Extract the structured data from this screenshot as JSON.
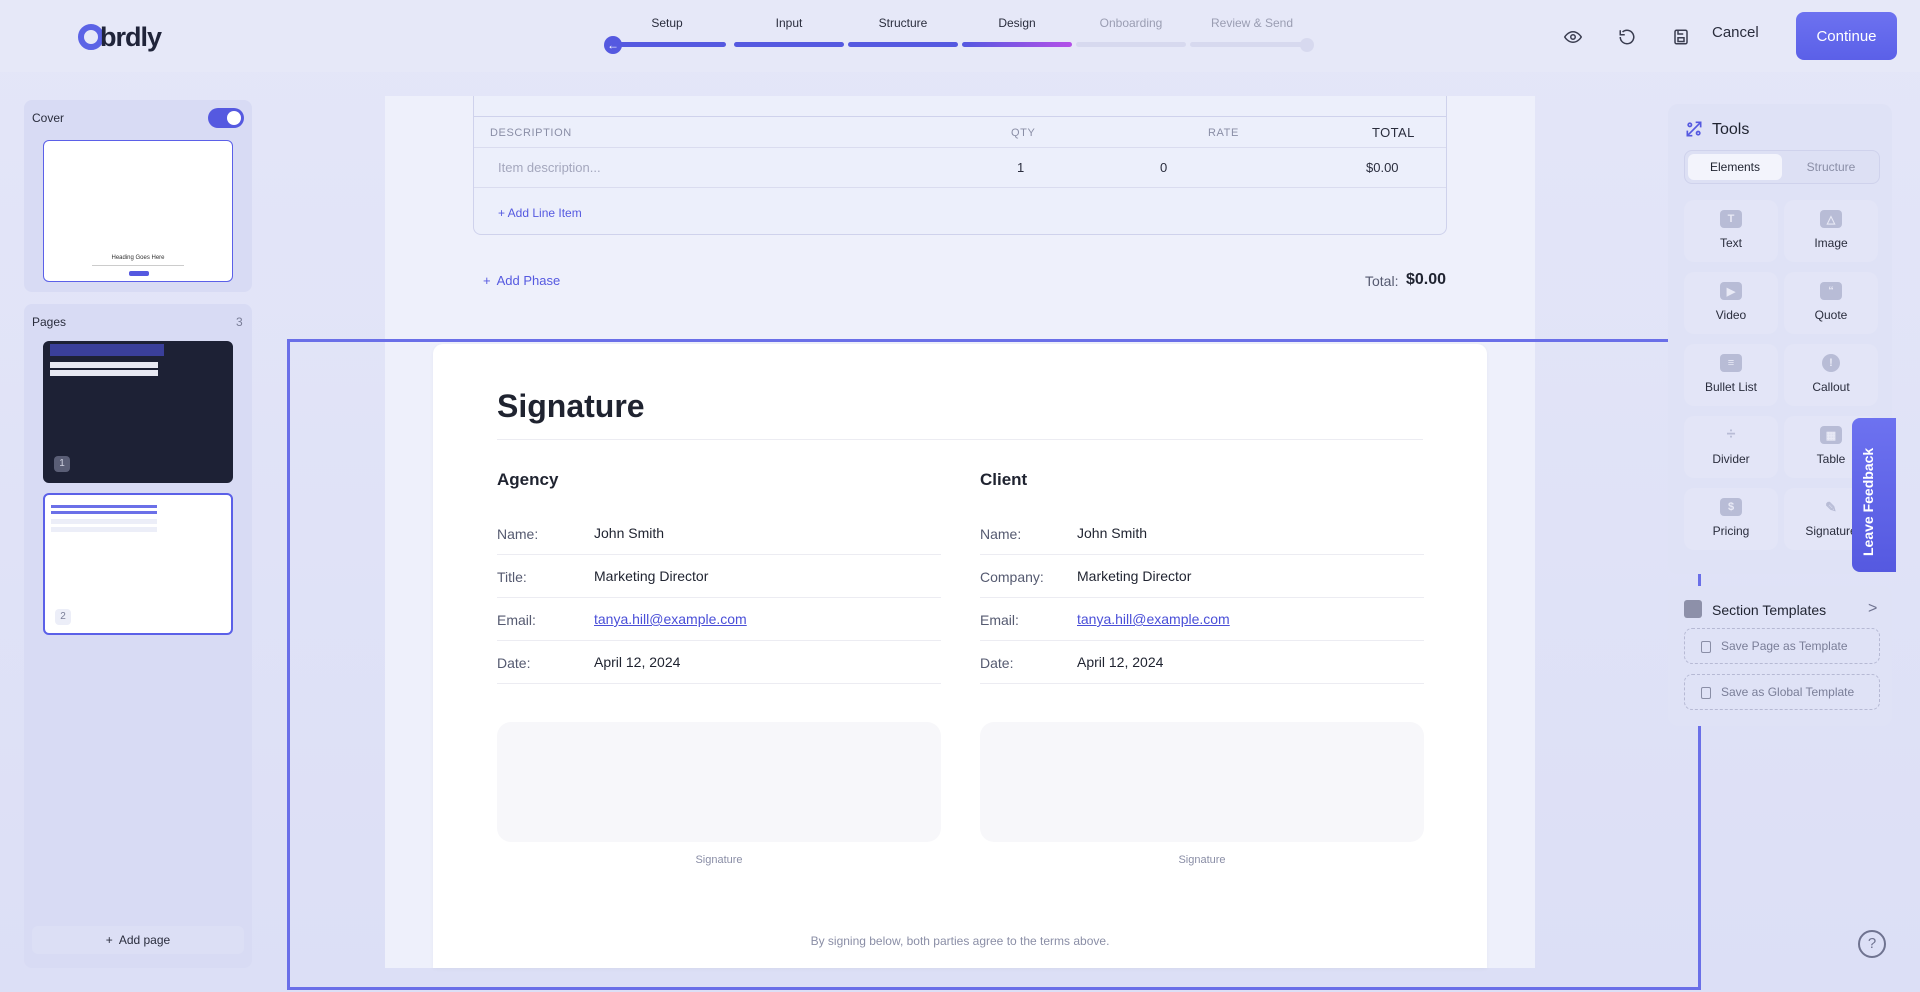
{
  "app": {
    "logo_text": "brdly",
    "colors": {
      "accent": "#5559e0",
      "accent_gradient_end": "#b450e8",
      "link": "#4a4fd8"
    }
  },
  "stepper": {
    "steps": [
      {
        "label": "Setup",
        "state": "done"
      },
      {
        "label": "Input",
        "state": "done"
      },
      {
        "label": "Structure",
        "state": "done"
      },
      {
        "label": "Design",
        "state": "active"
      },
      {
        "label": "Onboarding",
        "state": "pending"
      },
      {
        "label": "Review & Send",
        "state": "pending"
      }
    ]
  },
  "header_actions": {
    "preview_icon": "eye-icon",
    "history_icon": "undo-icon",
    "save_icon": "save-icon",
    "cancel_label": "Cancel",
    "continue_label": "Continue"
  },
  "left_panel": {
    "cover": {
      "label": "Cover",
      "enabled": true,
      "thumbnail_heading": "Heading Goes Here"
    },
    "pages": {
      "label": "Pages",
      "count": "3",
      "items": [
        {
          "number": "1"
        },
        {
          "number": "2"
        }
      ]
    },
    "add_page_label": "Add page"
  },
  "invoice": {
    "columns": {
      "description": "DESCRIPTION",
      "qty": "QTY",
      "rate": "RATE",
      "total": "TOTAL"
    },
    "rows": [
      {
        "description_placeholder": "Item description...",
        "qty": "1",
        "rate": "0",
        "total": "$0.00"
      }
    ],
    "add_line_label": "+ Add Line Item",
    "add_phase_label": "Add Phase",
    "total_label": "Total:",
    "total_value": "$0.00"
  },
  "signature": {
    "title": "Signature",
    "agency": {
      "heading": "Agency",
      "fields": [
        {
          "label": "Name:",
          "value": "John Smith"
        },
        {
          "label": "Title:",
          "value": "Marketing Director"
        },
        {
          "label": "Email:",
          "value": "tanya.hill@example.com"
        },
        {
          "label": "Date:",
          "value": "April 12, 2024"
        }
      ],
      "signature_caption": "Signature"
    },
    "client": {
      "heading": "Client",
      "fields": [
        {
          "label": "Name:",
          "value": "John Smith"
        },
        {
          "label": "Company:",
          "value": "Marketing Director"
        },
        {
          "label": "Email:",
          "value": "tanya.hill@example.com"
        },
        {
          "label": "Date:",
          "value": "April 12, 2024"
        }
      ],
      "signature_caption": "Signature"
    },
    "footer_note": "By signing below, both parties agree to the terms above."
  },
  "tools": {
    "title": "Tools",
    "tabs": {
      "elements": "Elements",
      "structure": "Structure"
    },
    "items": [
      {
        "label": "Text",
        "icon": "text-icon"
      },
      {
        "label": "Image",
        "icon": "image-icon"
      },
      {
        "label": "Video",
        "icon": "video-icon"
      },
      {
        "label": "Quote",
        "icon": "quote-icon"
      },
      {
        "label": "Bullet List",
        "icon": "bullet-list-icon"
      },
      {
        "label": "Callout",
        "icon": "callout-icon"
      },
      {
        "label": "Divider",
        "icon": "divider-icon"
      },
      {
        "label": "Table",
        "icon": "table-icon"
      },
      {
        "label": "Pricing",
        "icon": "pricing-icon"
      },
      {
        "label": "Signature",
        "icon": "signature-icon"
      }
    ]
  },
  "section_templates": {
    "title": "Section Templates",
    "save_page_label": "Save Page as Template",
    "save_global_label": "Save as Global Template"
  },
  "feedback_label": "Leave Feedback",
  "help_label": "?"
}
